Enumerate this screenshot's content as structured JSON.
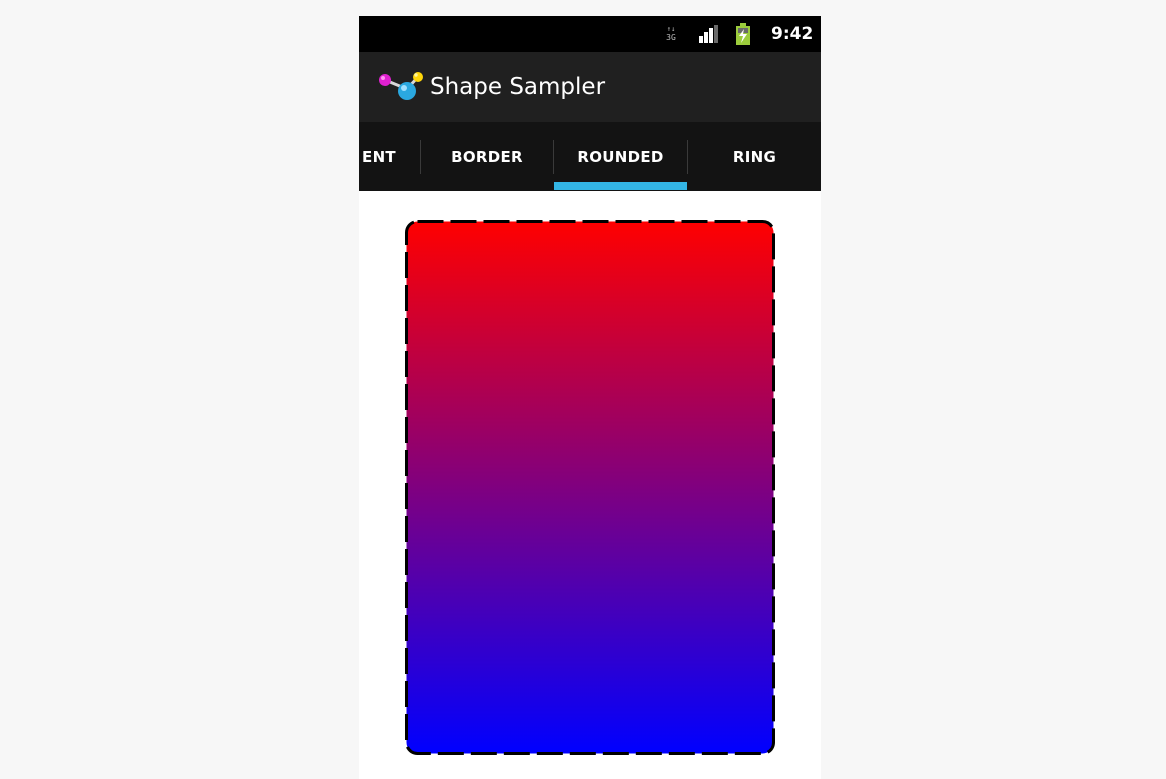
{
  "status_bar": {
    "network_type": "3G",
    "time": "9:42"
  },
  "action_bar": {
    "title": "Shape Sampler",
    "icon": "shape-sampler-app-icon"
  },
  "tabs": [
    {
      "label": "ENT",
      "selected": false
    },
    {
      "label": "BORDER",
      "selected": false
    },
    {
      "label": "ROUNDED",
      "selected": true
    },
    {
      "label": "RING",
      "selected": false
    }
  ],
  "shape": {
    "name": "rounded",
    "gradient_start_color": "#ff0000",
    "gradient_end_color": "#0000ff",
    "border_color": "#000000",
    "border_style": "dashed"
  },
  "colors": {
    "status_bar_bg": "#000000",
    "action_bar_bg": "#202020",
    "tab_strip_bg": "#131313",
    "tab_indicator": "#33b5e5",
    "page_bg": "#f7f7f7"
  }
}
